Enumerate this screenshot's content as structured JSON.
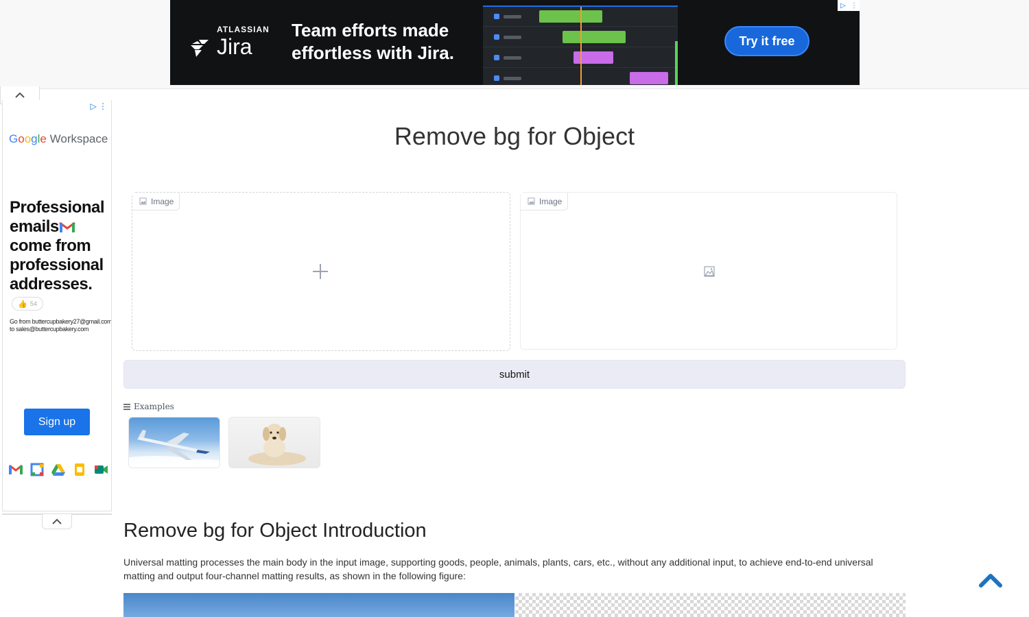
{
  "top_ad": {
    "brand_small": "ATLASSIAN",
    "brand_product": "Jira",
    "headline_line1": "Team efforts made",
    "headline_line2": "effortless with Jira.",
    "cta_label": "Try it free",
    "colors": {
      "background": "#101214",
      "cta": "#1868db"
    }
  },
  "side_ad": {
    "logo_google": [
      "G",
      "o",
      "o",
      "g",
      "l",
      "e"
    ],
    "logo_workspace": "Workspace",
    "headline": "Professional emails",
    "headline_rest": "come from professional addresses.",
    "reaction_count": "54",
    "small_text": "Go from buttercupbakery27@gmail.com to sales@buttercupbakery.com",
    "cta_label": "Sign up",
    "app_icons": [
      "gmail-icon",
      "calendar-icon",
      "drive-icon",
      "docs-icon",
      "meet-icon"
    ],
    "colors": {
      "cta": "#1a73e8"
    }
  },
  "main": {
    "title": "Remove bg for Object",
    "input_image_label": "Image",
    "output_image_label": "Image",
    "submit_label": "submit",
    "examples_label": "Examples",
    "examples": [
      "airplane-example",
      "dog-example"
    ]
  },
  "intro": {
    "title": "Remove bg for Object Introduction",
    "text": "Universal matting processes the main body in the input image, supporting goods, people, animals, plants, cars, etc., without any additional input, to achieve end-to-end universal matting and output four-channel matting results, as shown in the following figure:"
  }
}
